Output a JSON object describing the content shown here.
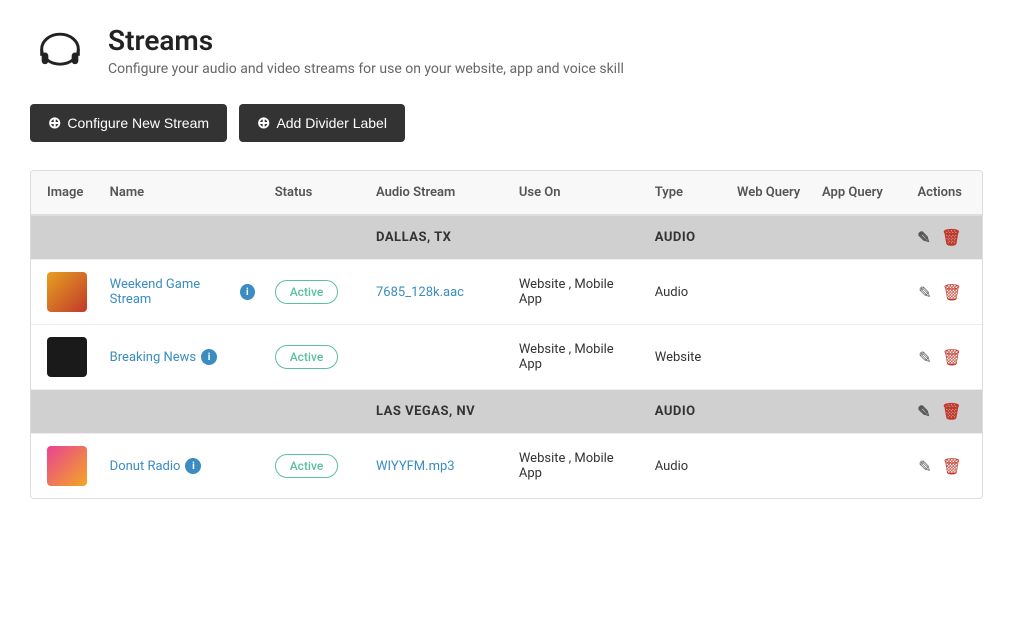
{
  "header": {
    "title": "Streams",
    "subtitle": "Configure your audio and video streams for use on your website, app and voice skill"
  },
  "buttons": {
    "configure": "Configure New Stream",
    "divider": "Add Divider Label"
  },
  "table": {
    "columns": [
      "Image",
      "Name",
      "Status",
      "Audio Stream",
      "Use On",
      "Type",
      "Web Query",
      "App Query",
      "Actions"
    ],
    "groups": [
      {
        "label": "DALLAS, TX",
        "type": "Audio",
        "rows": [
          {
            "name": "Weekend Game Stream",
            "status": "Active",
            "audio_stream": "7685_128k.aac",
            "use_on": "Website , Mobile App",
            "type": "Audio",
            "thumb_class": "thumb-weekend"
          },
          {
            "name": "Breaking News",
            "status": "Active",
            "audio_stream": "",
            "use_on": "Website , Mobile App",
            "type": "Website",
            "thumb_class": "thumb-breaking"
          }
        ]
      },
      {
        "label": "LAS VEGAS, NV",
        "type": "Audio",
        "rows": [
          {
            "name": "Donut Radio",
            "status": "Active",
            "audio_stream": "WIYYFM.mp3",
            "use_on": "Website , Mobile App",
            "type": "Audio",
            "thumb_class": "thumb-donut"
          }
        ]
      }
    ],
    "edit_label": "Edit",
    "delete_label": "Delete"
  }
}
